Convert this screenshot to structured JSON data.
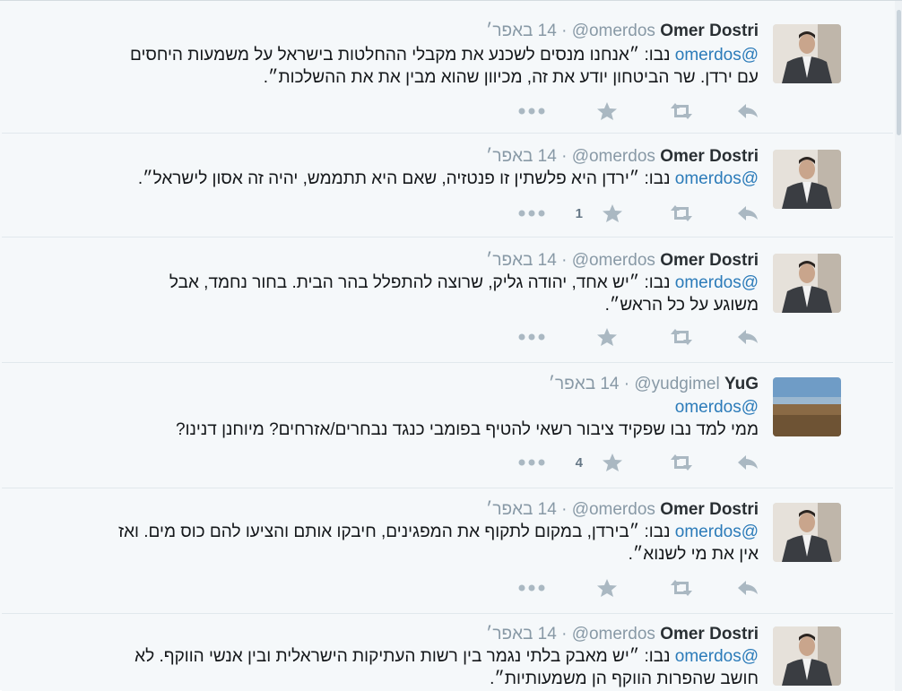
{
  "tweets": [
    {
      "name": "Omer Dostri",
      "handle": "@omerdos",
      "time": "14 באפר׳",
      "mention": "@omerdos",
      "body_lines": [
        "נבו: ״אנחנו מנסים לשכנע את מקבלי ההחלטות בישראל על משמעות היחסים",
        "עם ירדן. שר הביטחון יודע את זה, מכיוון שהוא מבין את את ההשלכות״."
      ],
      "favorite_count": "",
      "avatar": "person-in-suit"
    },
    {
      "name": "Omer Dostri",
      "handle": "@omerdos",
      "time": "14 באפר׳",
      "mention": "@omerdos",
      "body_lines": [
        "נבו: ״ירדן היא פלשתין זו פנטזיה, שאם היא תתממש, יהיה זה אסון לישראל״."
      ],
      "favorite_count": "1",
      "avatar": "person-in-suit"
    },
    {
      "name": "Omer Dostri",
      "handle": "@omerdos",
      "time": "14 באפר׳",
      "mention": "@omerdos",
      "body_lines": [
        "נבו: ״יש אחד, יהודה גליק, שרוצה להתפלל בהר הבית. בחור נחמד, אבל",
        "משוגע על כל הראש״."
      ],
      "favorite_count": "",
      "avatar": "person-in-suit"
    },
    {
      "name": "YuG",
      "handle": "@yudgimel",
      "time": "14 באפר׳",
      "mention": "@omerdos",
      "mention_own_line": true,
      "body_lines": [
        "ממי למד נבו שפקיד ציבור רשאי להטיף בפומבי כנגד נבחרים/אזרחים? מיוחנן דנינו?"
      ],
      "favorite_count": "4",
      "avatar": "landscape"
    },
    {
      "name": "Omer Dostri",
      "handle": "@omerdos",
      "time": "14 באפר׳",
      "mention": "@omerdos",
      "body_lines": [
        "נבו: ״בירדן, במקום לתקוף את המפגינים, חיבקו אותם והציעו להם כוס מים. ואז",
        "אין את מי לשנוא״."
      ],
      "favorite_count": "",
      "avatar": "person-in-suit"
    },
    {
      "name": "Omer Dostri",
      "handle": "@omerdos",
      "time": "14 באפר׳",
      "mention": "@omerdos",
      "body_lines": [
        "נבו: ״יש מאבק בלתי נגמר בין רשות העתיקות הישראלית ובין אנשי הווקף. לא",
        "חושב שהפרות הווקף הן משמעותיות״."
      ],
      "favorite_count": "",
      "avatar": "person-in-suit"
    }
  ],
  "colors": {
    "link": "#2b7bb9",
    "muted": "#8899a6",
    "icon": "#aab8c2",
    "background": "#f5f8fa"
  },
  "icons": [
    "reply-icon",
    "retweet-icon",
    "favorite-icon",
    "more-icon"
  ]
}
